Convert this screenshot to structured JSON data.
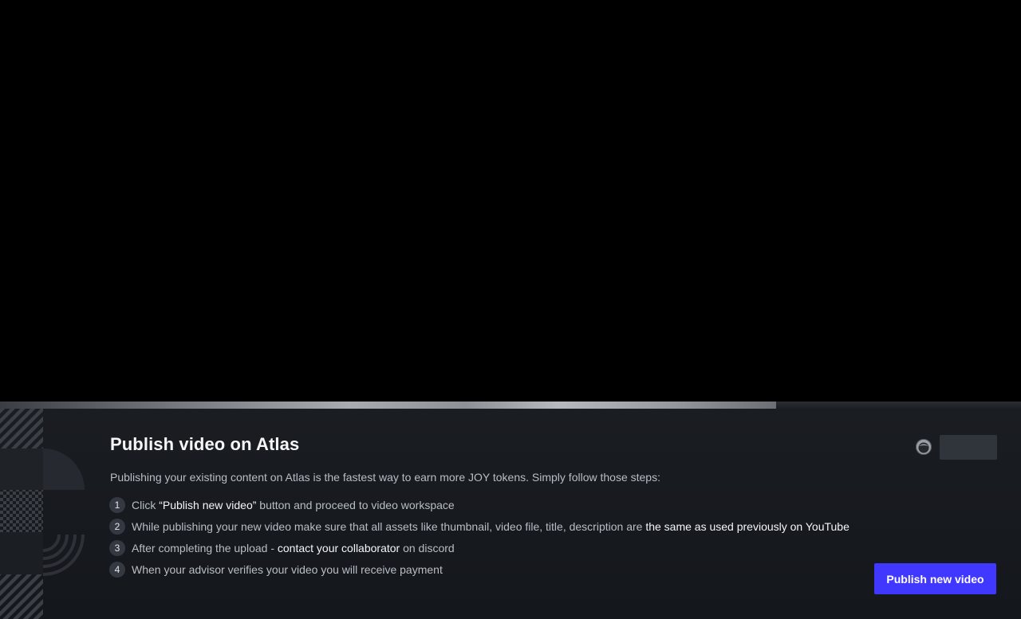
{
  "player": {
    "progress_fraction": 0.76
  },
  "onboarding": {
    "title": "Publish video on Atlas",
    "intro": "Publishing your existing content on Atlas is the fastest way to earn more JOY tokens. Simply follow those steps:",
    "steps": [
      {
        "number": "1",
        "before": "Click ",
        "highlight": "“Publish new video”",
        "after": " button and proceed to video workspace"
      },
      {
        "number": "2",
        "before": "While publishing your new video make sure that all assets like thumbnail, video file, title, description are ",
        "highlight": "the same as used previously on YouTube",
        "after": ""
      },
      {
        "number": "3",
        "before": "After completing the upload - ",
        "highlight": "contact your collaborator",
        "after": " on discord"
      },
      {
        "number": "4",
        "before": "When your advisor verifies your video you will receive payment",
        "highlight": "",
        "after": ""
      }
    ],
    "publish_button_label": "Publish new video"
  },
  "icons": {
    "avatar": "avatar-icon",
    "decoration": "decorative-pattern-icon"
  },
  "colors": {
    "accent": "#4038ff",
    "panel_background": "#1a1d22",
    "text_primary": "#f4f6f8",
    "text_secondary": "#b9bec6"
  }
}
